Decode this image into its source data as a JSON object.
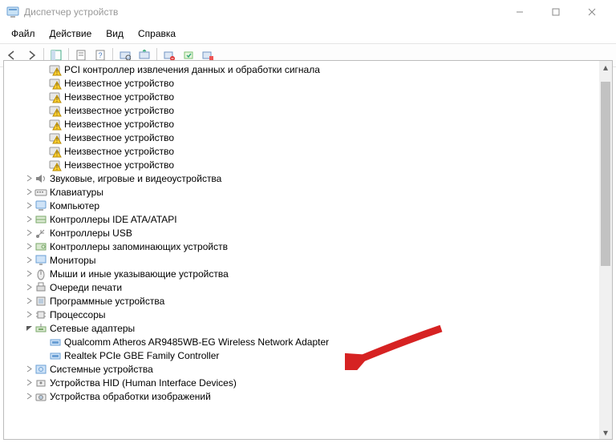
{
  "window": {
    "title": "Диспетчер устройств"
  },
  "menu": {
    "file": "Файл",
    "action": "Действие",
    "view": "Вид",
    "help": "Справка"
  },
  "tree": {
    "unknown_devices": [
      "PCI контроллер извлечения данных и обработки сигнала",
      "Неизвестное устройство",
      "Неизвестное устройство",
      "Неизвестное устройство",
      "Неизвестное устройство",
      "Неизвестное устройство",
      "Неизвестное устройство",
      "Неизвестное устройство"
    ],
    "categories": [
      {
        "label": "Звуковые, игровые и видеоустройства",
        "icon": "sound"
      },
      {
        "label": "Клавиатуры",
        "icon": "keyboard"
      },
      {
        "label": "Компьютер",
        "icon": "computer"
      },
      {
        "label": "Контроллеры IDE ATA/ATAPI",
        "icon": "ide"
      },
      {
        "label": "Контроллеры USB",
        "icon": "usb"
      },
      {
        "label": "Контроллеры запоминающих устройств",
        "icon": "storage"
      },
      {
        "label": "Мониторы",
        "icon": "monitor"
      },
      {
        "label": "Мыши и иные указывающие устройства",
        "icon": "mouse"
      },
      {
        "label": "Очереди печати",
        "icon": "printer"
      },
      {
        "label": "Программные устройства",
        "icon": "software"
      },
      {
        "label": "Процессоры",
        "icon": "cpu"
      },
      {
        "label": "Сетевые адаптеры",
        "icon": "network",
        "expanded": true,
        "children": [
          "Qualcomm Atheros AR9485WB-EG Wireless Network Adapter",
          "Realtek PCIe GBE Family Controller"
        ]
      },
      {
        "label": "Системные устройства",
        "icon": "system"
      },
      {
        "label": "Устройства HID (Human Interface Devices)",
        "icon": "hid"
      },
      {
        "label": "Устройства обработки изображений",
        "icon": "imaging"
      }
    ]
  }
}
